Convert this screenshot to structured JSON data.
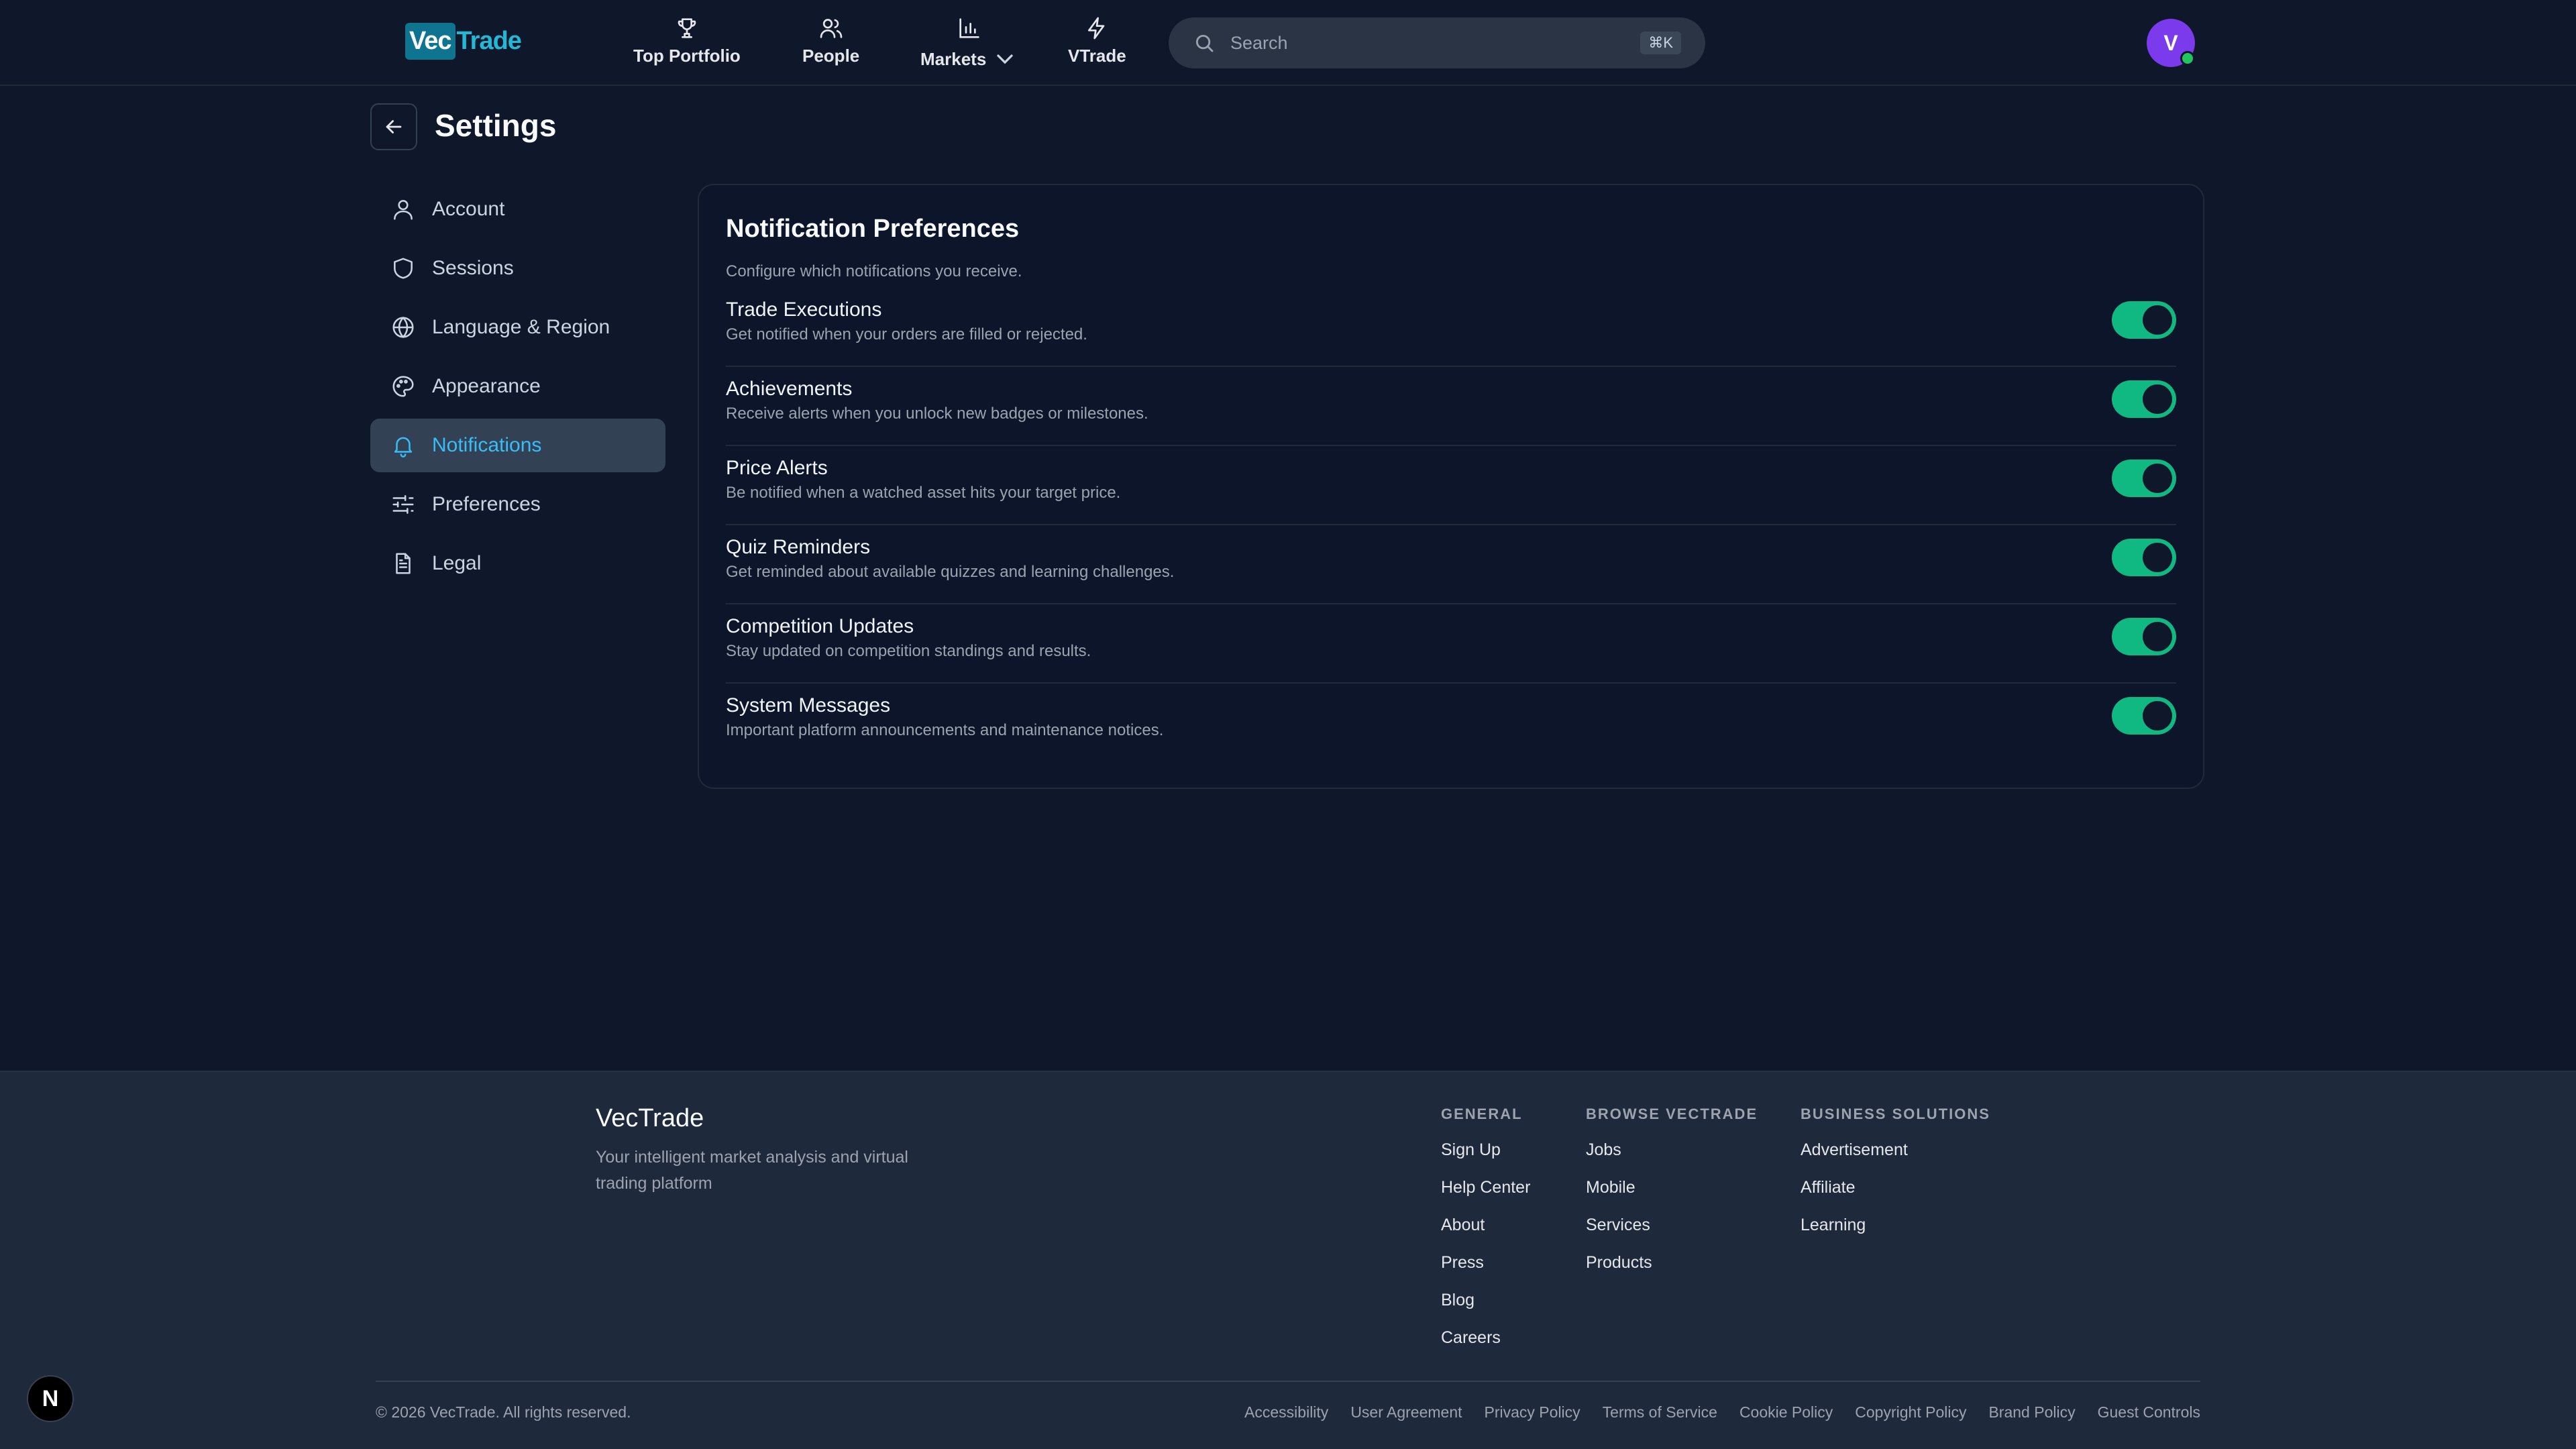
{
  "header": {
    "logo_part1": "Vec",
    "logo_part2": "Trade",
    "nav": [
      {
        "label": "Top Portfolio",
        "icon": "trophy-icon"
      },
      {
        "label": "People",
        "icon": "users-icon"
      },
      {
        "label": "Markets",
        "icon": "bar-chart-icon"
      },
      {
        "label": "VTrade",
        "icon": "lightning-icon"
      }
    ],
    "search_placeholder": "Search",
    "search_shortcut": "⌘K",
    "avatar_initial": "V"
  },
  "settings": {
    "title": "Settings",
    "sidebar": [
      {
        "label": "Account",
        "icon": "user-icon"
      },
      {
        "label": "Sessions",
        "icon": "shield-icon"
      },
      {
        "label": "Language & Region",
        "icon": "globe-icon"
      },
      {
        "label": "Appearance",
        "icon": "palette-icon"
      },
      {
        "label": "Notifications",
        "icon": "bell-icon",
        "active": true
      },
      {
        "label": "Preferences",
        "icon": "sliders-icon"
      },
      {
        "label": "Legal",
        "icon": "document-icon"
      }
    ]
  },
  "panel": {
    "title": "Notification Preferences",
    "description": "Configure which notifications you receive.",
    "preferences": [
      {
        "name": "Trade Executions",
        "text": "Get notified when your orders are filled or rejected.",
        "enabled": true
      },
      {
        "name": "Achievements",
        "text": "Receive alerts when you unlock new badges or milestones.",
        "enabled": true
      },
      {
        "name": "Price Alerts",
        "text": "Be notified when a watched asset hits your target price.",
        "enabled": true
      },
      {
        "name": "Quiz Reminders",
        "text": "Get reminded about available quizzes and learning challenges.",
        "enabled": true
      },
      {
        "name": "Competition Updates",
        "text": "Stay updated on competition standings and results.",
        "enabled": true
      },
      {
        "name": "System Messages",
        "text": "Important platform announcements and maintenance notices.",
        "enabled": true
      }
    ]
  },
  "footer": {
    "brand": "VecTrade",
    "tagline": "Your intelligent market analysis and virtual trading platform",
    "columns": [
      {
        "title": "GENERAL",
        "links": [
          "Sign Up",
          "Help Center",
          "About",
          "Press",
          "Blog",
          "Careers"
        ]
      },
      {
        "title": "BROWSE VECTRADE",
        "links": [
          "Jobs",
          "Mobile",
          "Services",
          "Products"
        ]
      },
      {
        "title": "BUSINESS SOLUTIONS",
        "links": [
          "Advertisement",
          "Affiliate",
          "Learning"
        ]
      }
    ],
    "copyright": "© 2026 VecTrade. All rights reserved.",
    "legal_links": [
      "Accessibility",
      "User Agreement",
      "Privacy Policy",
      "Terms of Service",
      "Cookie Policy",
      "Copyright Policy",
      "Brand Policy",
      "Guest Controls"
    ]
  },
  "dev_badge": "N",
  "colors": {
    "background": "#0f172a",
    "footer": "#1e293b",
    "accent": "#38bdf8",
    "toggle_on": "#10b981",
    "avatar": "#7c3aed"
  }
}
